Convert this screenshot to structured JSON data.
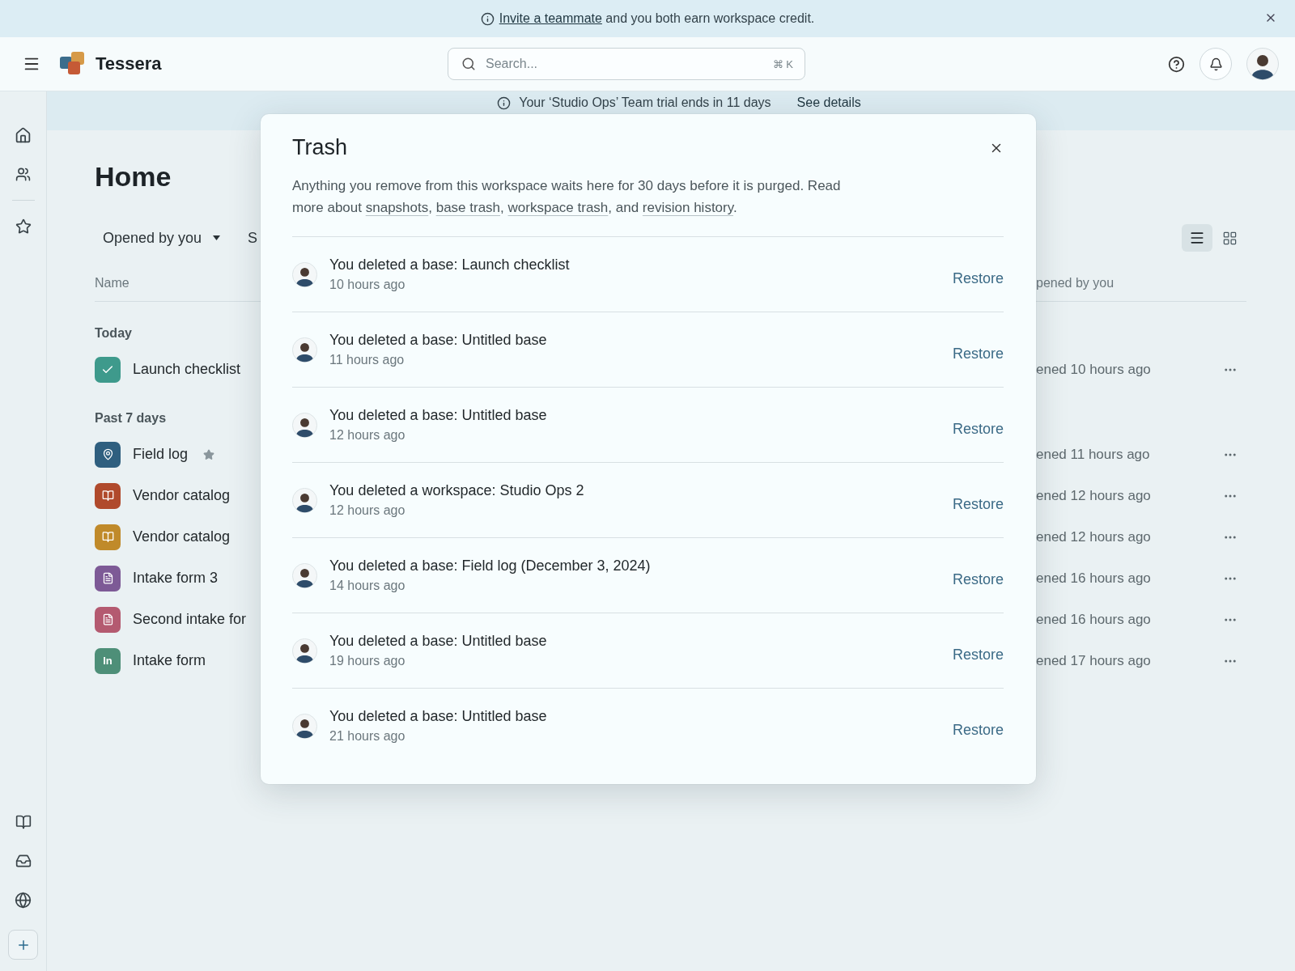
{
  "announcement": {
    "link": "Invite a teammate",
    "text": "and you both earn workspace credit."
  },
  "header": {
    "app_name": "Tessera",
    "search": {
      "placeholder": "Search...",
      "shortcut": "⌘ K"
    }
  },
  "trial_banner": {
    "text": "Your ‘Studio Ops’ Team trial ends in 11 days",
    "link": "See details"
  },
  "home": {
    "title": "Home",
    "filters": [
      {
        "label": "Opened by you",
        "dropdown": true
      },
      {
        "label": "S",
        "dropdown": false
      }
    ],
    "view_modes": [
      {
        "kind": "list",
        "selected": true
      },
      {
        "kind": "grid",
        "selected": false
      }
    ],
    "columns": [
      "Name",
      "pened by you"
    ],
    "groups": [
      {
        "label": "Today",
        "items": [
          {
            "name": "Launch checklist",
            "kind": "check",
            "color": "#3e9a8c",
            "starred": false,
            "opened": "ened 10 hours ago"
          }
        ]
      },
      {
        "label": "Past 7 days",
        "items": [
          {
            "name": "Field log",
            "kind": "pin",
            "color": "#2f5f7f",
            "starred": true,
            "opened": "ened 11 hours ago"
          },
          {
            "name": "Vendor catalog",
            "kind": "book",
            "color": "#b04a2c",
            "starred": false,
            "opened": "ened 12 hours ago"
          },
          {
            "name": "Vendor catalog",
            "kind": "book",
            "color": "#c08a2a",
            "starred": false,
            "opened": "ened 12 hours ago"
          },
          {
            "name": "Intake form 3",
            "kind": "doc",
            "color": "#7d5a96",
            "starred": false,
            "opened": "ened 16 hours ago"
          },
          {
            "name": "Second intake for",
            "kind": "doc",
            "color": "#b45a70",
            "starred": false,
            "opened": "ened 16 hours ago"
          },
          {
            "name": "Intake form",
            "kind": "initials",
            "initials": "In",
            "color": "#4e8f78",
            "starred": false,
            "opened": "ened 17 hours ago"
          }
        ]
      }
    ]
  },
  "trash": {
    "title": "Trash",
    "description": [
      {
        "kind": "text",
        "text": "Anything you remove from this workspace waits here for 30 days before it is purged. Read more about "
      },
      {
        "kind": "link",
        "text": "snapshots"
      },
      {
        "kind": "text",
        "text": ", "
      },
      {
        "kind": "link",
        "text": "base trash"
      },
      {
        "kind": "text",
        "text": ", "
      },
      {
        "kind": "link",
        "text": "workspace trash"
      },
      {
        "kind": "text",
        "text": ", and "
      },
      {
        "kind": "link",
        "text": "revision history"
      },
      {
        "kind": "text",
        "text": "."
      }
    ],
    "entries": [
      {
        "title": "You deleted a base: Launch checklist",
        "time": "10 hours ago",
        "action": "Restore"
      },
      {
        "title": "You deleted a base: Untitled base",
        "time": "11 hours ago",
        "action": "Restore"
      },
      {
        "title": "You deleted a base: Untitled base",
        "time": "12 hours ago",
        "action": "Restore"
      },
      {
        "title": "You deleted a workspace: Studio Ops 2",
        "time": "12 hours ago",
        "action": "Restore"
      },
      {
        "title": "You deleted a base: Field log (December 3, 2024)",
        "time": "14 hours ago",
        "action": "Restore"
      },
      {
        "title": "You deleted a base: Untitled base",
        "time": "19 hours ago",
        "action": "Restore"
      },
      {
        "title": "You deleted a base: Untitled base",
        "time": "21 hours ago",
        "action": "Restore"
      }
    ]
  }
}
